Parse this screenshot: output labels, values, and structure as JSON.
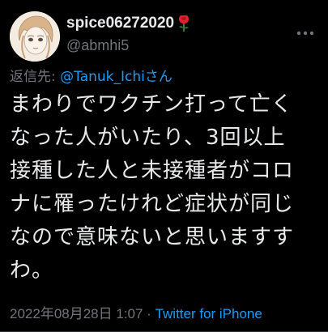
{
  "tweet": {
    "display_name": "spice06272020",
    "handle": "@abmhi5",
    "reply_prefix": "返信先: ",
    "reply_to": "@Tanuk_Ichiさん",
    "text_lines": [
      "まわりでワクチン打って亡く",
      "なった人がいたり、3回以上",
      "接種した人と未接種者がコロ",
      "ナに罹ったけれど症状が同じ",
      "なので意味ないと思いますす",
      "わ。"
    ],
    "timestamp": "2022年08月28日 1:07",
    "separator": " · ",
    "source": "Twitter for iPhone"
  },
  "icons": {
    "name_emoji": "rose-icon",
    "menu": "more-icon"
  },
  "colors": {
    "background": "#000000",
    "text": "#e7e9ea",
    "muted": "#71767b",
    "link": "#1d9bf0",
    "rose": "#e0202e"
  }
}
